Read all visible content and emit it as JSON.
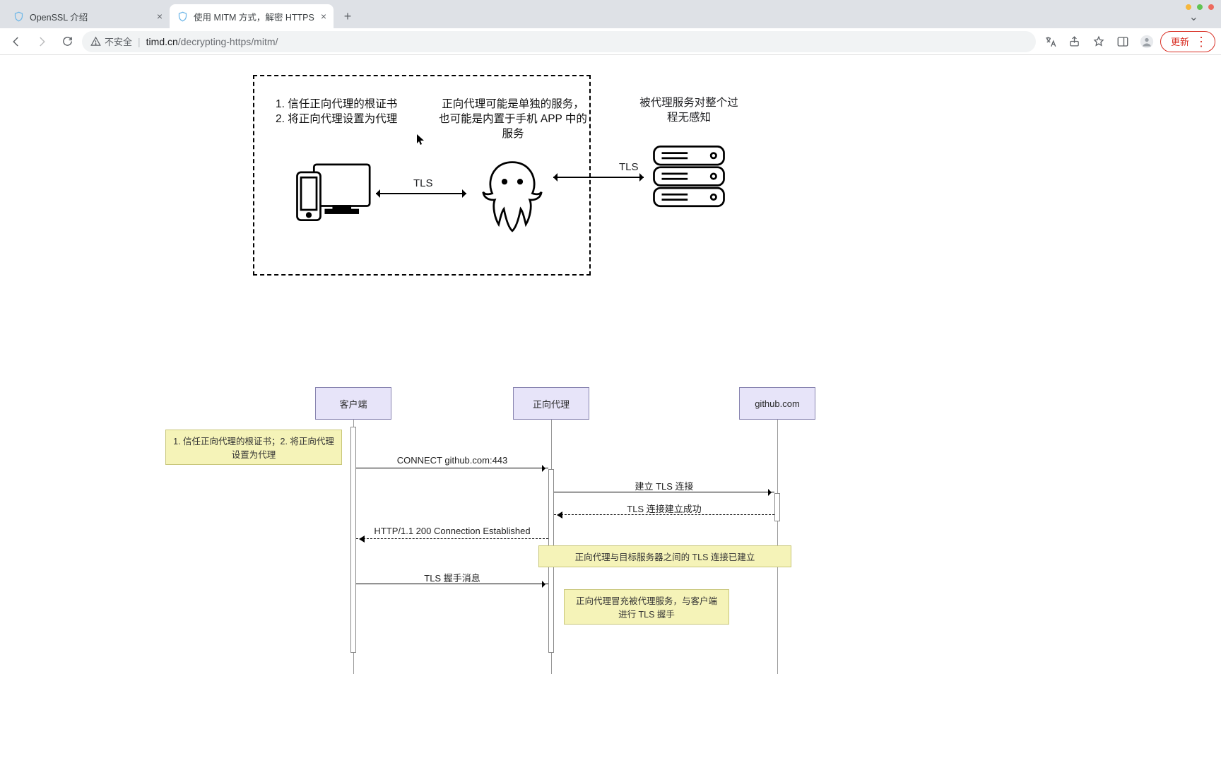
{
  "browser": {
    "tabs": [
      {
        "title": "OpenSSL 介绍",
        "active": false
      },
      {
        "title": "使用 MITM 方式，解密 HTTPS",
        "active": true
      }
    ],
    "security_label": "不安全",
    "url_host": "timd.cn",
    "url_path": "/decrypting-https/mitm/",
    "update_label": "更新"
  },
  "diagram1": {
    "left_caption_1": "1. 信任正向代理的根证书",
    "left_caption_2": "2. 将正向代理设置为代理",
    "mid_caption": "正向代理可能是单独的服务，也可能是内置于手机 APP 中的服务",
    "right_caption": "被代理服务对整个过程无感知",
    "tls_label": "TLS"
  },
  "sequence": {
    "actors": {
      "client": "客户端",
      "proxy": "正向代理",
      "server": "github.com"
    },
    "note1": "1. 信任正向代理的根证书；2. 将正向代理设置为代理",
    "note2": "正向代理与目标服务器之间的 TLS 连接已建立",
    "note3": "正向代理冒充被代理服务，与客户端进行 TLS 握手",
    "msgs": {
      "m1": "CONNECT github.com:443",
      "m2": "建立 TLS 连接",
      "m3": "TLS 连接建立成功",
      "m4": "HTTP/1.1 200 Connection Established",
      "m5": "TLS 握手消息"
    }
  }
}
